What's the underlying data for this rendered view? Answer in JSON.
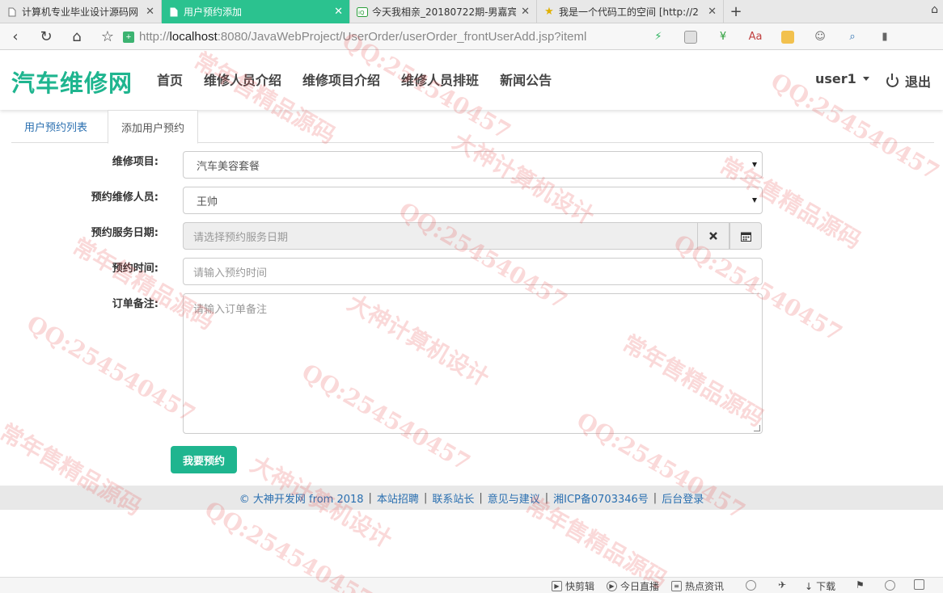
{
  "browser": {
    "tabs": [
      {
        "title": "计算机专业毕业设计源码网",
        "icon": "page-icon",
        "active": false
      },
      {
        "title": "用户预约添加",
        "icon": "page-icon",
        "active": true
      },
      {
        "title": "今天我相亲_20180722期-男嘉宾",
        "icon": "video-icon",
        "active": false
      },
      {
        "title": "我是一个代码工的空间 [http://2",
        "icon": "star-icon",
        "active": false
      }
    ],
    "url_scheme": "http://",
    "url_host": "localhost",
    "url_rest": ":8080/JavaWebProject/UserOrder/userOrder_frontUserAdd.jsp?iteml"
  },
  "site": {
    "brand": "汽车维修网",
    "nav": [
      "首页",
      "维修人员介绍",
      "维修项目介绍",
      "维修人员排班",
      "新闻公告"
    ],
    "user": "user1",
    "logout": "退出"
  },
  "page_tabs": {
    "list": "用户预约列表",
    "add": "添加用户预约"
  },
  "form": {
    "project_label": "维修项目:",
    "project_value": "汽车美容套餐",
    "staff_label": "预约维修人员:",
    "staff_value": "王帅",
    "date_label": "预约服务日期:",
    "date_placeholder": "请选择预约服务日期",
    "time_label": "预约时间:",
    "time_placeholder": "请输入预约时间",
    "note_label": "订单备注:",
    "note_placeholder": "请输入订单备注",
    "submit": "我要预约"
  },
  "footer": {
    "links": [
      "© 大神开发网 from 2018",
      "本站招聘",
      "联系站长",
      "意见与建议",
      "湘ICP备0703346号",
      "后台登录"
    ]
  },
  "statusbar": {
    "items": [
      "快剪辑",
      "今日直播",
      "热点资讯",
      "下载"
    ]
  },
  "watermark": {
    "lines": [
      "QQ:254540457",
      "常年售精品源码",
      "大神计算机设计"
    ]
  },
  "colors": {
    "accent": "#1fb58f",
    "active_tab": "#2bc28f",
    "link": "#2a6fb0"
  }
}
